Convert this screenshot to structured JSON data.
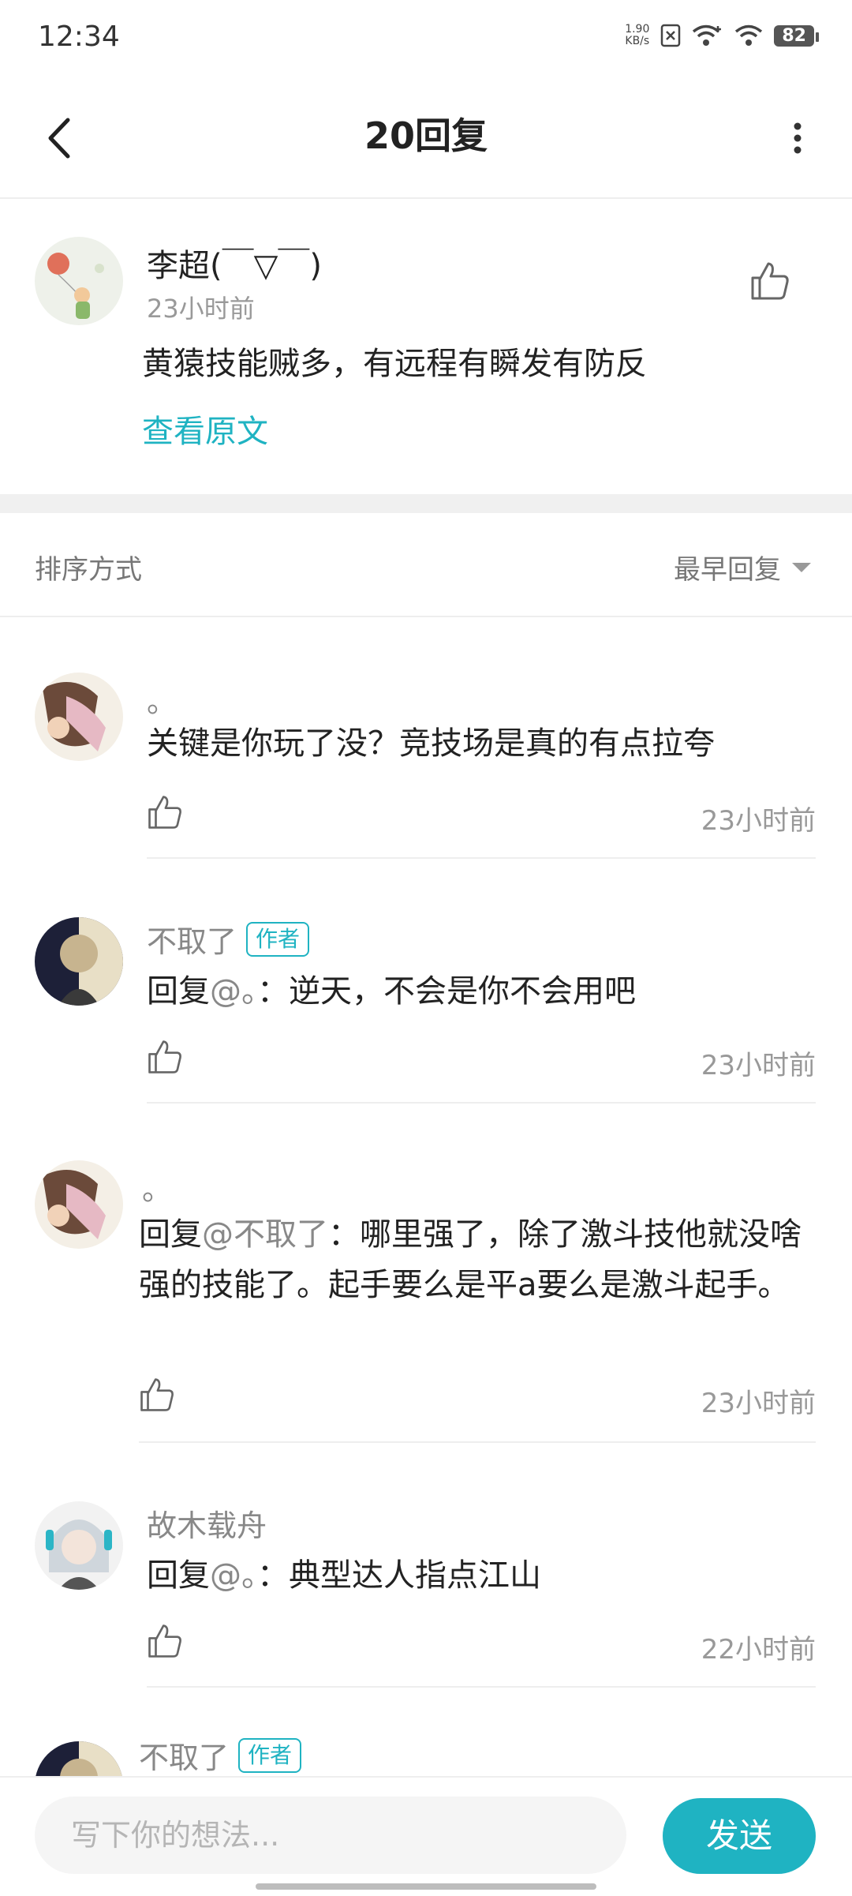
{
  "status_bar": {
    "time": "12:34",
    "speed_value": "1.90",
    "speed_unit": "KB/s",
    "battery": "82"
  },
  "header": {
    "title": "20回复"
  },
  "original": {
    "name": "李超(￣▽￣)",
    "time": "23小时前",
    "text": "黄猿技能贼多，有远程有瞬发有防反",
    "view_original": "查看原文"
  },
  "sort": {
    "label": "排序方式",
    "value": "最早回复"
  },
  "replies": [
    {
      "name": "。",
      "badge": "",
      "prefix": "",
      "mention": "",
      "text": "关键是你玩了没？竞技场是真的有点拉夸",
      "time": "23小时前"
    },
    {
      "name": "不取了",
      "badge": "作者",
      "prefix": "回复",
      "mention": "@。",
      "text": "：逆天，不会是你不会用吧",
      "time": "23小时前"
    },
    {
      "name": "。",
      "badge": "",
      "prefix": "回复",
      "mention": "@不取了",
      "text": "：哪里强了，除了激斗技他就没啥强的技能了。起手要么是平a要么是激斗起手。",
      "time": "23小时前"
    },
    {
      "name": "故木载舟",
      "badge": "",
      "prefix": "回复",
      "mention": "@。",
      "text": "：典型达人指点江山",
      "time": "22小时前"
    },
    {
      "name": "不取了",
      "badge": "作者"
    }
  ],
  "composer": {
    "placeholder": "写下你的想法...",
    "send_label": "发送"
  },
  "colors": {
    "accent": "#1fb3c2",
    "divider": "#eeeeee"
  },
  "icons": [
    "back-arrow-icon",
    "more-vertical-icon",
    "thumbs-up-icon",
    "wifi-icon",
    "battery-icon",
    "sort-caret-icon"
  ]
}
